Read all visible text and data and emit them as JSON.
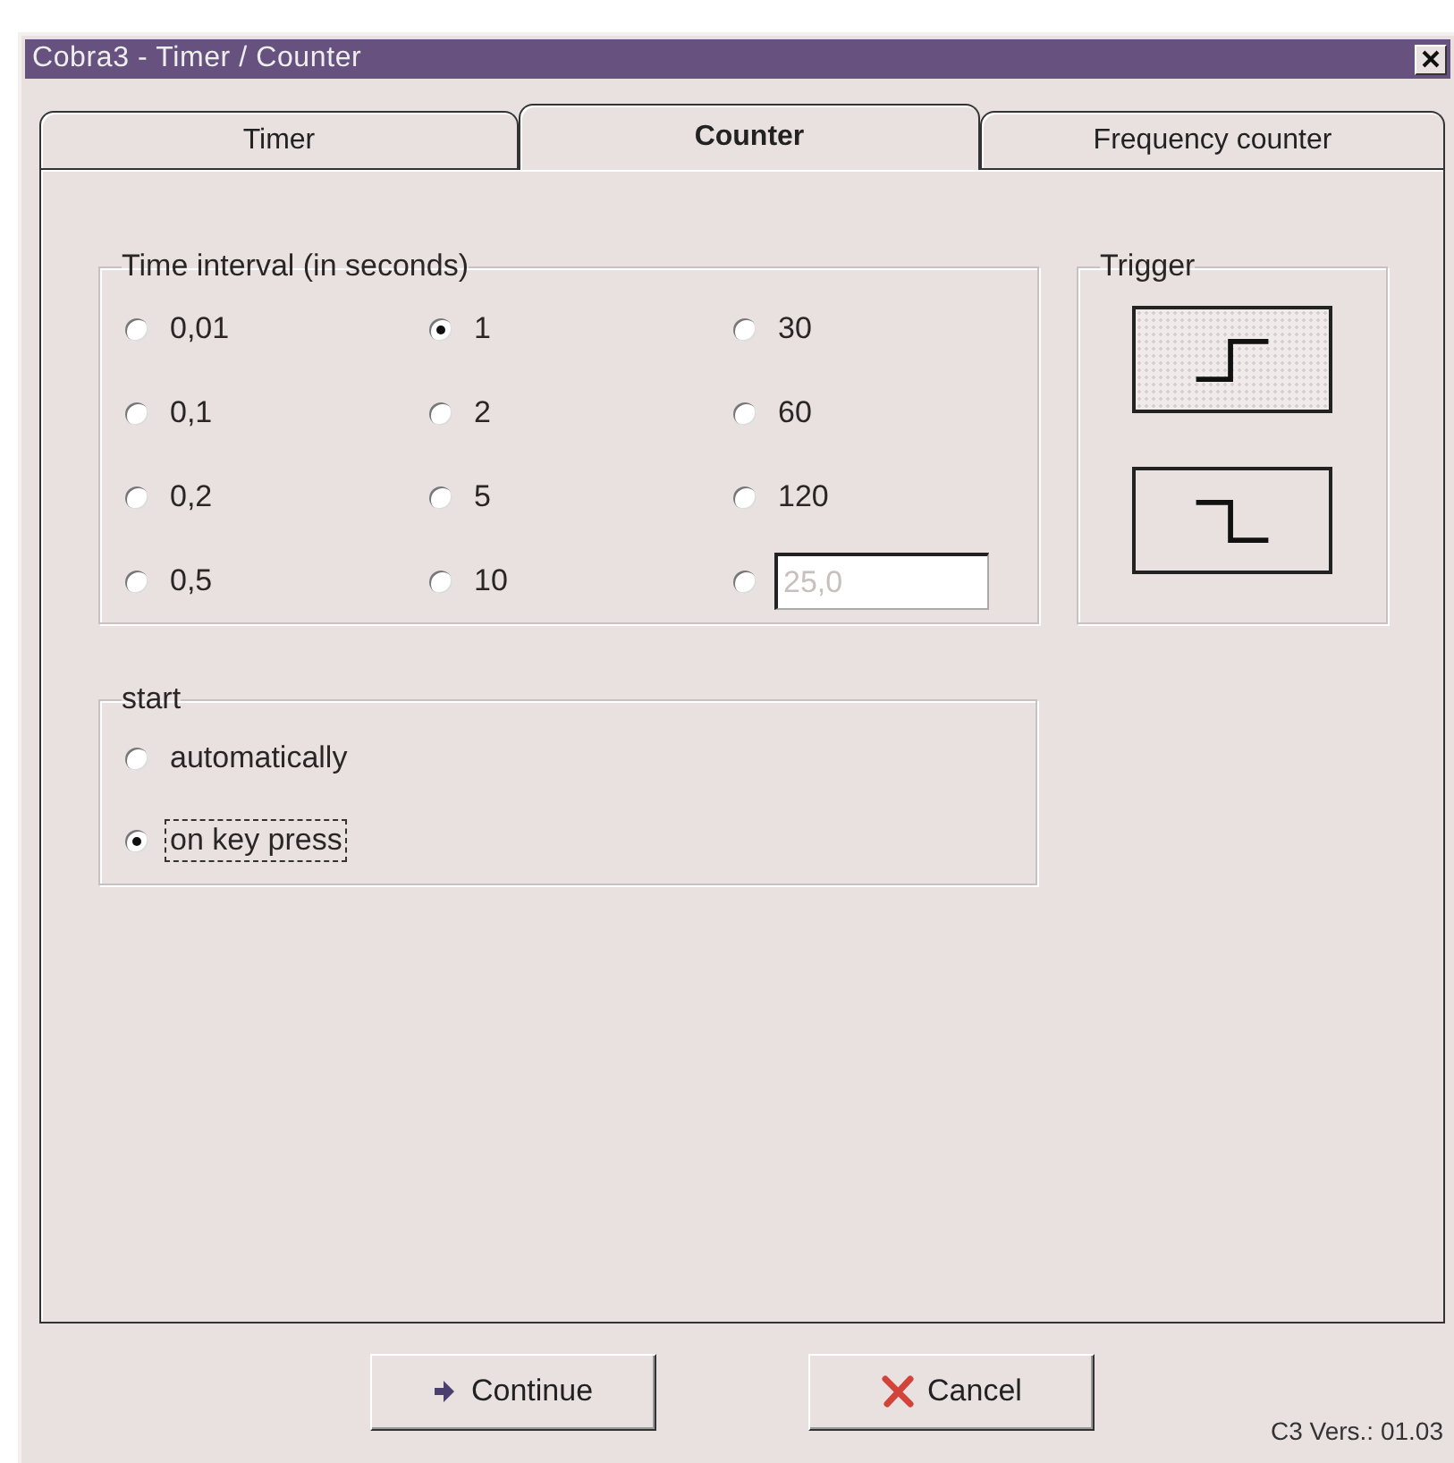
{
  "window": {
    "title": "Cobra3 - Timer / Counter"
  },
  "tabs": [
    {
      "label": "Timer",
      "selected": false
    },
    {
      "label": "Counter",
      "selected": true
    },
    {
      "label": "Frequency counter",
      "selected": false
    }
  ],
  "time_interval": {
    "legend": "Time interval (in seconds)",
    "options": [
      {
        "kind": "option",
        "label": "0,01",
        "selected": false
      },
      {
        "kind": "option",
        "label": "1",
        "selected": true
      },
      {
        "kind": "option",
        "label": "30",
        "selected": false
      },
      {
        "kind": "option",
        "label": "0,1",
        "selected": false
      },
      {
        "kind": "option",
        "label": "2",
        "selected": false
      },
      {
        "kind": "option",
        "label": "60",
        "selected": false
      },
      {
        "kind": "option",
        "label": "0,2",
        "selected": false
      },
      {
        "kind": "option",
        "label": "5",
        "selected": false
      },
      {
        "kind": "option",
        "label": "120",
        "selected": false
      },
      {
        "kind": "option",
        "label": "0,5",
        "selected": false
      },
      {
        "kind": "option",
        "label": "10",
        "selected": false
      },
      {
        "kind": "field",
        "value": "25,0",
        "disabled": true,
        "selected": false
      }
    ]
  },
  "trigger": {
    "legend": "Trigger",
    "options": [
      {
        "kind": "rising",
        "selected": true
      },
      {
        "kind": "falling",
        "selected": false
      }
    ]
  },
  "start": {
    "legend": "start",
    "options": [
      {
        "label": "automatically",
        "selected": false,
        "focused": false
      },
      {
        "label": "on key press",
        "selected": true,
        "focused": true
      }
    ]
  },
  "buttons": [
    {
      "kind": "continue",
      "label": "Continue"
    },
    {
      "kind": "cancel",
      "label": "Cancel"
    }
  ],
  "version": "C3 Vers.: 01.03"
}
